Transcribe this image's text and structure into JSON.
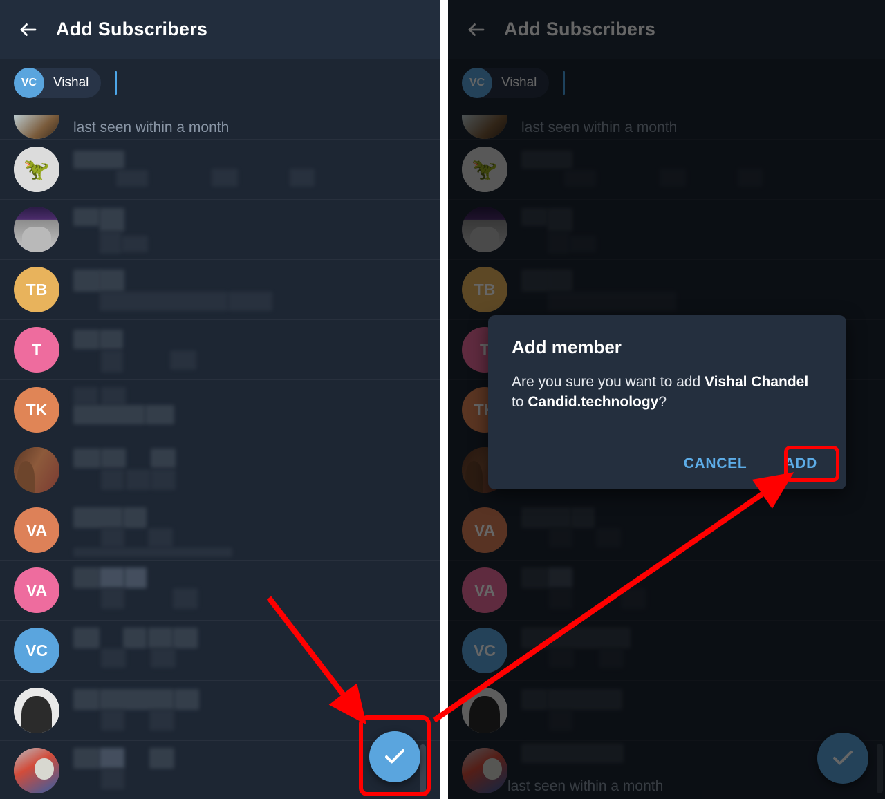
{
  "app": {
    "screen_title": "Add Subscribers",
    "back_icon": "arrow-left-icon"
  },
  "chip": {
    "initials": "VC",
    "name": "Vishal"
  },
  "list": {
    "status_text": "last seen within a month",
    "rows": [
      {
        "id": "row-top-cut",
        "avatar_kind": "photo",
        "photo": "ph-girl",
        "initials": "",
        "color": "#b9c8cc",
        "status": "last seen within a month",
        "selected": false
      },
      {
        "id": "row-dino",
        "avatar_kind": "photo",
        "photo": "ph-dino",
        "initials": "",
        "color": "#dcdcdc",
        "status": "",
        "selected": false
      },
      {
        "id": "row-galaxy",
        "avatar_kind": "photo",
        "photo": "ph-galaxy",
        "initials": "",
        "color": "#4b2c6b",
        "status": "",
        "selected": false
      },
      {
        "id": "row-tb",
        "avatar_kind": "initials",
        "photo": "",
        "initials": "TB",
        "color": "#e8b35c",
        "status": "",
        "selected": false
      },
      {
        "id": "row-t",
        "avatar_kind": "initials",
        "photo": "",
        "initials": "T",
        "color": "#ee6c9e",
        "status": "",
        "selected": false
      },
      {
        "id": "row-tk",
        "avatar_kind": "initials",
        "photo": "",
        "initials": "TK",
        "color": "#e08556",
        "status": "",
        "selected": false
      },
      {
        "id": "row-group",
        "avatar_kind": "photo",
        "photo": "ph-grp",
        "initials": "",
        "color": "#8d5a3b",
        "status": "",
        "selected": false
      },
      {
        "id": "row-va-1",
        "avatar_kind": "initials",
        "photo": "",
        "initials": "VA",
        "color": "#dd8158",
        "status": "",
        "selected": false
      },
      {
        "id": "row-va-2",
        "avatar_kind": "initials",
        "photo": "",
        "initials": "VA",
        "color": "#ee6c9e",
        "status": "",
        "selected": false
      },
      {
        "id": "row-vc",
        "avatar_kind": "initials",
        "photo": "",
        "initials": "VC",
        "color": "#5aa5de",
        "status": "",
        "selected": true
      },
      {
        "id": "row-bw",
        "avatar_kind": "photo",
        "photo": "ph-bw",
        "initials": "",
        "color": "#e9e9e9",
        "status": "",
        "selected": false
      },
      {
        "id": "row-family",
        "avatar_kind": "photo",
        "photo": "ph-fam",
        "initials": "",
        "color": "#d24c3a",
        "status": "last seen within a month",
        "selected": false
      }
    ]
  },
  "fab": {
    "icon": "check-icon",
    "color": "#5aa5de"
  },
  "dialog": {
    "title": "Add member",
    "body_prefix": "Are you sure you want to add ",
    "body_name": "Vishal Chandel",
    "body_mid": " to ",
    "body_target": "Candid.technology",
    "body_suffix": "?",
    "cancel_label": "CANCEL",
    "add_label": "ADD",
    "accent_color": "#5dade8"
  },
  "annotations": {
    "highlight_color": "#ff0000",
    "fab_highlight": "highlight-box-fab",
    "add_highlight": "highlight-box-add",
    "arrow_to_fab": "arrow-pointing-to-fab",
    "arrow_to_add": "arrow-pointing-to-add"
  },
  "theme": {
    "background": "#1d2633",
    "appbar": "#222d3d",
    "dialog_bg": "#242f3e",
    "selected_badge": "#3ec35a"
  }
}
